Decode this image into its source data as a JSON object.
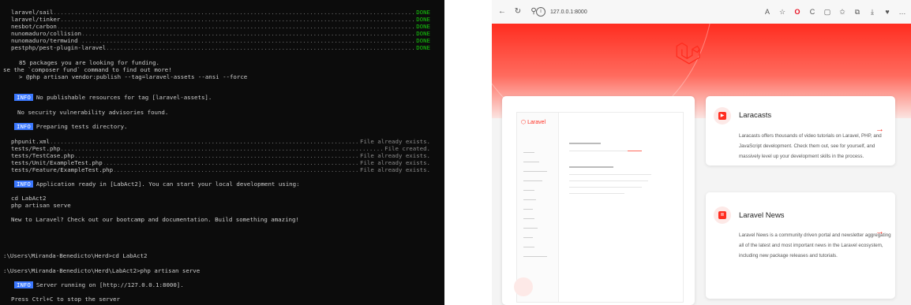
{
  "terminal": {
    "packages": [
      {
        "name": "laravel/sail",
        "status": "DONE"
      },
      {
        "name": "laravel/tinker",
        "status": "DONE"
      },
      {
        "name": "nesbot/carbon",
        "status": "DONE"
      },
      {
        "name": "nunomaduro/collision",
        "status": "DONE"
      },
      {
        "name": "nunomaduro/termwind",
        "status": "DONE"
      },
      {
        "name": "pestphp/pest-plugin-laravel",
        "status": "DONE"
      }
    ],
    "funding_1": "85 packages you are looking for funding.",
    "funding_2": "se the `composer fund` command to find out more!",
    "publish_cmd": "> @php artisan vendor:publish --tag=laravel-assets --ansi --force",
    "info_label": "INFO",
    "info_1": "No publishable resources for tag [laravel-assets].",
    "security": "No security vulnerability advisories found.",
    "info_2": "Preparing tests directory.",
    "files": [
      {
        "name": "phpunit.xml",
        "status": "File already exists."
      },
      {
        "name": "tests/Pest.php",
        "status": "File created."
      },
      {
        "name": "tests/TestCase.php",
        "status": "File already exists."
      },
      {
        "name": "tests/Unit/ExampleTest.php",
        "status": "File already exists."
      },
      {
        "name": "tests/Feature/ExampleTest.php",
        "status": "File already exists."
      }
    ],
    "info_3": "Application ready in [LabAct2]. You can start your local development using:",
    "cmd_cd": "cd LabAct2",
    "cmd_serve": "php artisan serve",
    "new_to": "New to Laravel? Check out our bootcamp and documentation. Build something amazing!",
    "prompt_1": ":\\Users\\Miranda-Benedicto\\Herd>cd LabAct2",
    "prompt_2": ":\\Users\\Miranda-Benedicto\\Herd\\LabAct2>php artisan serve",
    "info_4": "Server running on [http://127.0.0.1:8000].",
    "stop": "Press Ctrl+C to stop the server"
  },
  "browser": {
    "url": "127.0.0.1:8000",
    "mini_brand": "Laravel",
    "cards": [
      {
        "title": "Laracasts",
        "description": "Laracasts offers thousands of video tutorials on Laravel, PHP, and JavaScript development. Check them out, see for yourself, and massively level up your development skills in the process."
      },
      {
        "title": "Laravel News",
        "description": "Laravel News is a community driven portal and newsletter aggregating all of the latest and most important news in the Laravel ecosystem, including new package releases and tutorials."
      }
    ]
  },
  "colors": {
    "terminal_bg": "#0c0c0c",
    "done_green": "#16c60c",
    "info_blue": "#3b78ff",
    "laravel_red": "#ff2d20"
  }
}
